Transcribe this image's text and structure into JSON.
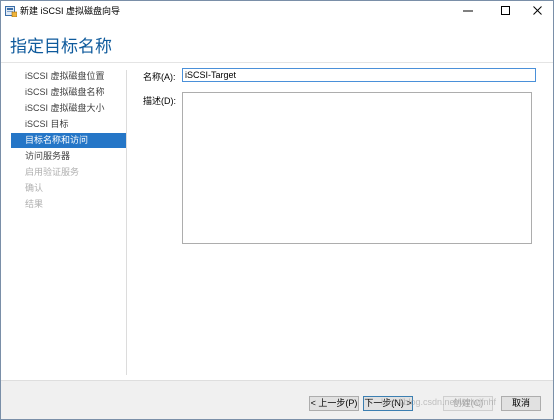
{
  "window": {
    "title": "新建 iSCSI 虚拟磁盘向导",
    "icon": "wizard-app-icon",
    "controls": [
      "minimize-icon",
      "maximize-icon",
      "close-icon"
    ]
  },
  "header": {
    "title": "指定目标名称"
  },
  "nav": {
    "items": [
      {
        "label": "iSCSI 虚拟磁盘位置",
        "state": "normal"
      },
      {
        "label": "iSCSI 虚拟磁盘名称",
        "state": "normal"
      },
      {
        "label": "iSCSI 虚拟磁盘大小",
        "state": "normal"
      },
      {
        "label": "iSCSI 目标",
        "state": "normal"
      },
      {
        "label": "目标名称和访问",
        "state": "active"
      },
      {
        "label": "访问服务器",
        "state": "normal"
      },
      {
        "label": "启用验证服务",
        "state": "disabled"
      },
      {
        "label": "确认",
        "state": "disabled"
      },
      {
        "label": "结果",
        "state": "disabled"
      }
    ]
  },
  "form": {
    "name_label": "名称(A):",
    "name_value": "iSCSI-Target",
    "description_label": "描述(D):",
    "description_value": ""
  },
  "footer": {
    "previous_label": "< 上一步(P)",
    "next_label": "下一步(N) >",
    "create_label": "创建(C)",
    "cancel_label": "取消"
  },
  "watermark": "http://blog.csdn.net/wylwjfnhf",
  "colors": {
    "accent": "#2576c7",
    "heading": "#0e5a9c"
  }
}
